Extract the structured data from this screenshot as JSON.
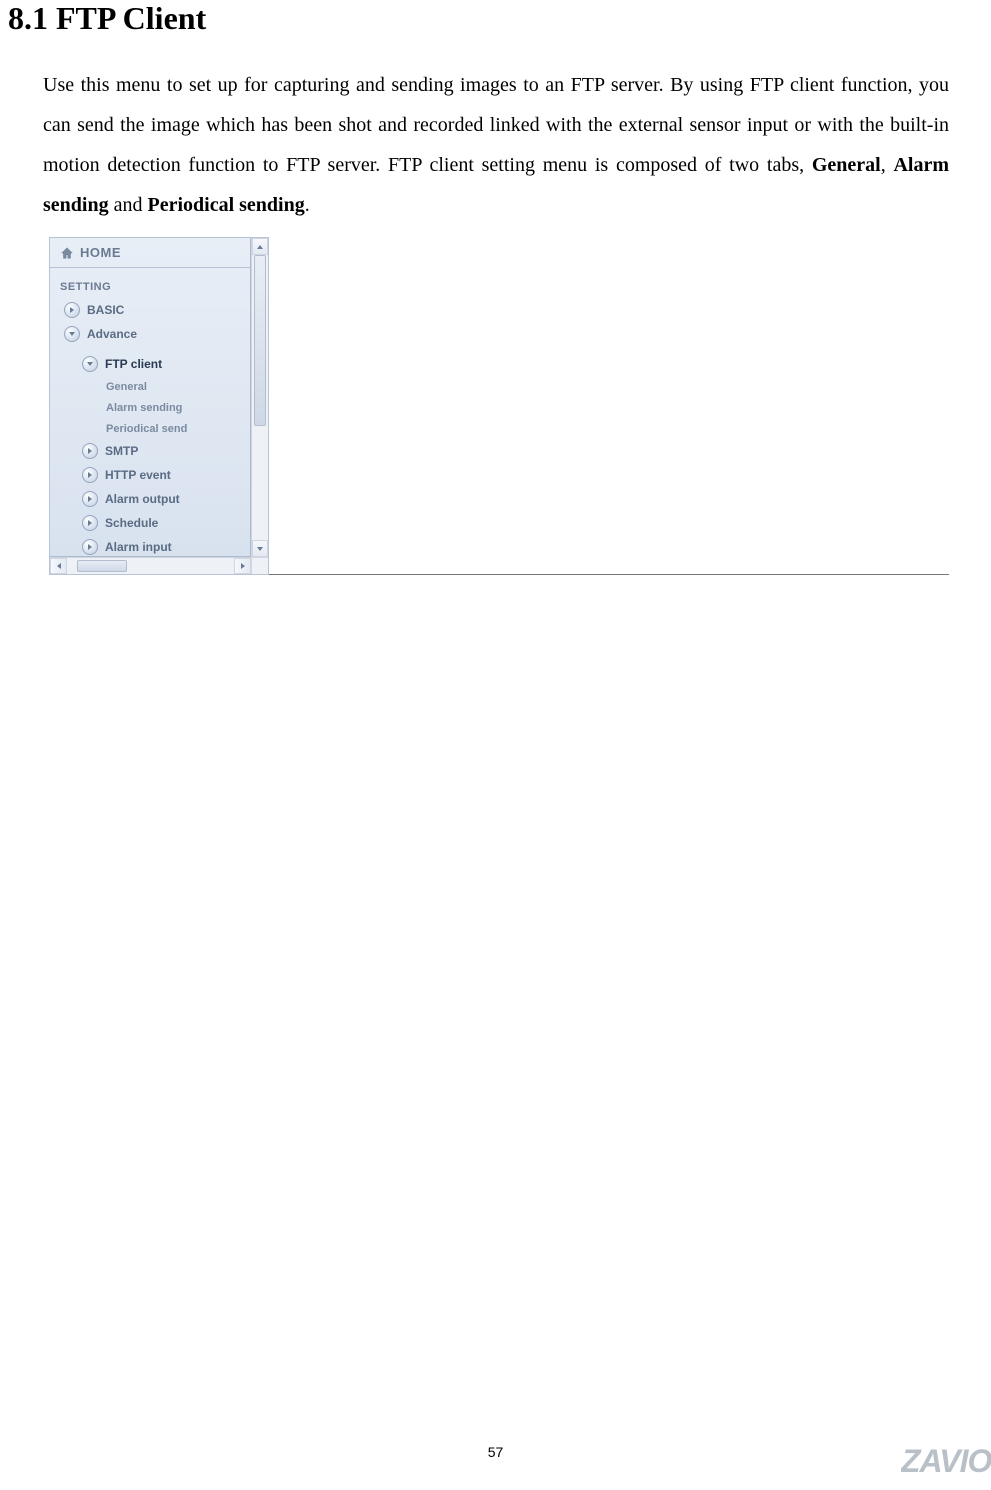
{
  "heading": "8.1 FTP Client",
  "paragraph": {
    "p1": "Use this menu to set up for capturing and sending images to an FTP server. By using FTP client function, you can send the image which has been shot and recorded linked with the external sensor input or with the built-in motion detection function to FTP server. FTP client setting menu is composed of two tabs, ",
    "b1": "General",
    "p2": ", ",
    "b2": "Alarm sending",
    "p3": " and ",
    "b3": "Periodical sending",
    "p4": "."
  },
  "nav": {
    "home": "HOME",
    "setting": "SETTING",
    "basic": "BASIC",
    "advance": "Advance",
    "ftp_client": "FTP client",
    "general": "General",
    "alarm_sending": "Alarm sending",
    "periodical_sending": "Periodical send",
    "smtp": "SMTP",
    "http_event": "HTTP event",
    "alarm_output": "Alarm output",
    "schedule": "Schedule",
    "alarm_input": "Alarm input"
  },
  "page_number": "57",
  "footer_brand": "ZAVIO"
}
